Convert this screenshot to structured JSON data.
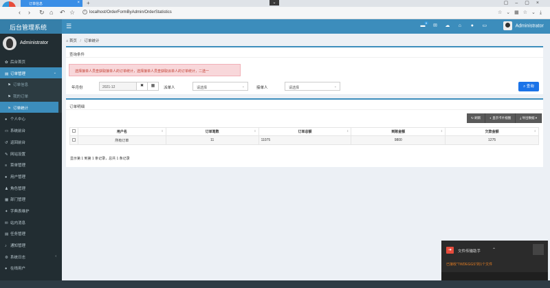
{
  "browser": {
    "tab_title": "订单信息",
    "url": "localhost/OrderFormByAdmin/OrderStatistics"
  },
  "header": {
    "brand": "后台管理系统",
    "user": "Administrator",
    "message_badge": "6"
  },
  "sidebar": {
    "user": "Administrator",
    "items": [
      {
        "label": "后台首页",
        "icon": "gear-icon"
      },
      {
        "label": "订单管理",
        "icon": "cart-icon",
        "active": true
      },
      {
        "label": "订单信息",
        "icon": "flag-icon",
        "sub": true
      },
      {
        "label": "我的订单",
        "icon": "flag-icon",
        "sub": true
      },
      {
        "label": "订单统计",
        "icon": "flag-icon",
        "sub": true,
        "current": true
      },
      {
        "label": "个人中心",
        "icon": "user-icon"
      },
      {
        "label": "系统前台",
        "icon": "monitor-icon"
      },
      {
        "label": "返回前台",
        "icon": "return-icon"
      },
      {
        "label": "网站设置",
        "icon": "settings-icon"
      },
      {
        "label": "菜单管理",
        "icon": "menu-icon"
      },
      {
        "label": "用户管理",
        "icon": "user-icon"
      },
      {
        "label": "角色管理",
        "icon": "role-icon"
      },
      {
        "label": "部门管理",
        "icon": "dept-icon"
      },
      {
        "label": "字典表维护",
        "icon": "dict-icon"
      },
      {
        "label": "站内消息",
        "icon": "mail-icon"
      },
      {
        "label": "任务管理",
        "icon": "task-icon"
      },
      {
        "label": "通知管理",
        "icon": "bell-icon"
      },
      {
        "label": "系统日志",
        "icon": "log-icon"
      },
      {
        "label": "在线用户",
        "icon": "users-icon"
      }
    ]
  },
  "breadcrumb": {
    "home": "首页",
    "current": "订单统计"
  },
  "query": {
    "title": "查询条件",
    "alert": "选择接单人员查获取接单人的订单统计，选择接单人员查获取派单人的订单统计，二选一",
    "month_label": "年月份",
    "month_value": "2021-12",
    "dispatcher_label": "派单人",
    "dispatcher_value": "请选择",
    "receiver_label": "接单人",
    "receiver_value": "请选择",
    "search_label": "查询"
  },
  "details": {
    "title": "订单明细",
    "toolbar": {
      "refresh": "刷新",
      "card_view": "显示卡片视图",
      "export": "导出数据"
    },
    "columns": [
      "用户名",
      "订单笔数",
      "订单总额",
      "到账金额",
      "欠款金额"
    ],
    "rows": [
      [
        "所有订单",
        "11",
        "11075",
        "9800",
        "1275"
      ]
    ],
    "pager": "显示第 1 到第 1 条记录，总共 1 条记录"
  },
  "download": {
    "title": "文件传输助手",
    "message": "已接收\"TWDEGGS\"的1个文件"
  }
}
